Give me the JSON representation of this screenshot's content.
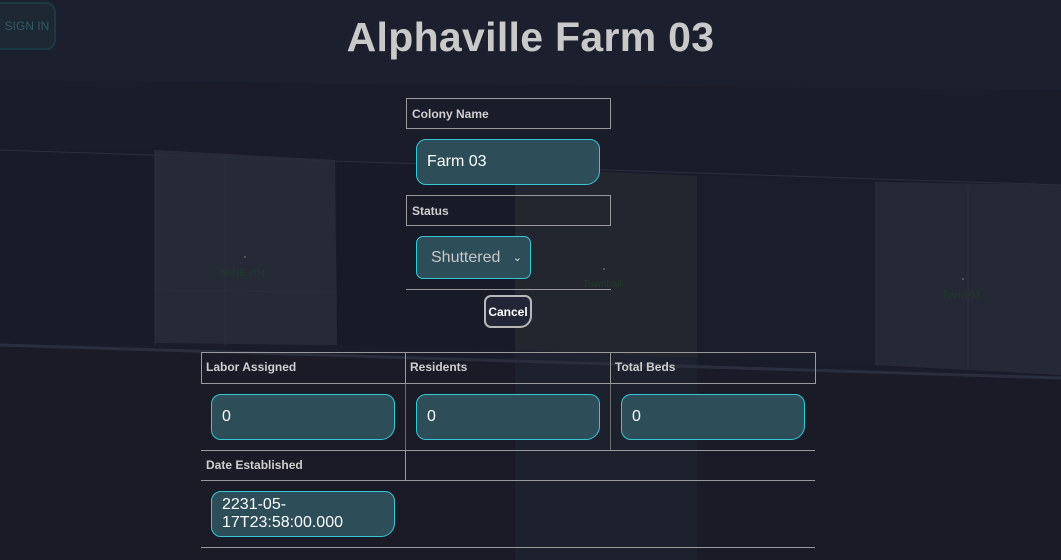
{
  "map": {
    "labels": [
      "MINE #04",
      "Townhall",
      "Farm 03"
    ]
  },
  "header": {
    "signin_label": "SIGN IN",
    "title": "Alphaville Farm 03"
  },
  "form": {
    "colony_name_label": "Colony Name",
    "colony_name_value": "Farm 03",
    "status_label": "Status",
    "status_value": "Shuttered",
    "cancel_label": "Cancel"
  },
  "stats": {
    "labor_label": "Labor Assigned",
    "labor_value": "0",
    "residents_label": "Residents",
    "residents_value": "0",
    "beds_label": "Total Beds",
    "beds_value": "0",
    "date_label": "Date Established",
    "date_value": "2231-05-17T23:58:00.000"
  },
  "colors": {
    "background": "#1b1c2a",
    "field_fill": "#2d4d58",
    "field_border": "#35c9d8",
    "title_text": "#c9c9c9"
  }
}
